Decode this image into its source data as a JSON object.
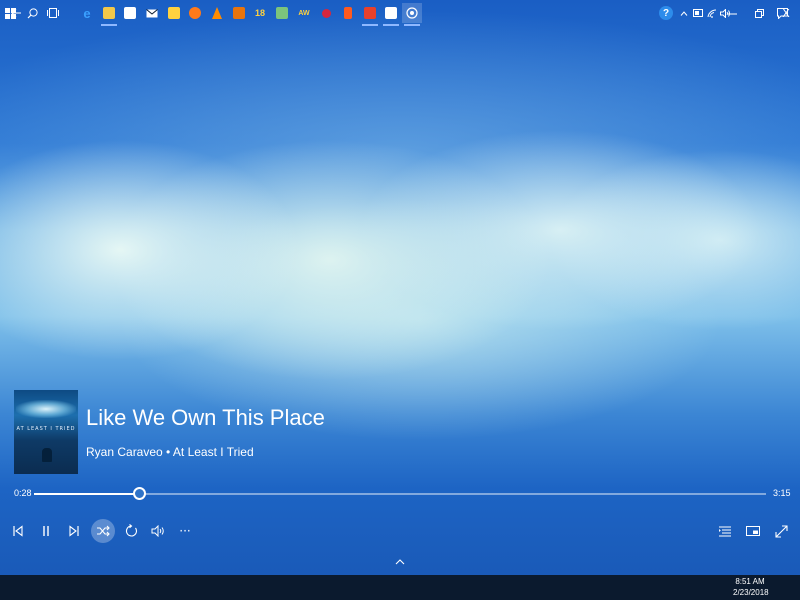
{
  "window": {
    "back_icon": "arrow-left-icon",
    "minimize_icon": "minimize-icon",
    "restore_icon": "restore-icon",
    "close_label": "X"
  },
  "now_playing": {
    "title": "Like We Own This Place",
    "subtitle": "Ryan Caraveo • At Least I Tried",
    "album_art_text": "AT LEAST I TRIED"
  },
  "progress": {
    "elapsed": "0:28",
    "total": "3:15",
    "fraction": 0.1436
  },
  "controls": {
    "items": [
      "previous-icon",
      "pause-icon",
      "next-icon",
      "shuffle-icon",
      "repeat-icon",
      "volume-icon",
      "more-icon"
    ],
    "right_items": [
      "now-playing-list-icon",
      "mini-player-icon",
      "full-screen-icon"
    ],
    "more_label": "···"
  },
  "taskbar": {
    "badge_18": "18",
    "badge_aw": "AW",
    "time": "8:51 AM",
    "date": "2/23/2018"
  },
  "colors": {
    "accent": "#1565c0",
    "taskbar": "#0b1a2e"
  }
}
